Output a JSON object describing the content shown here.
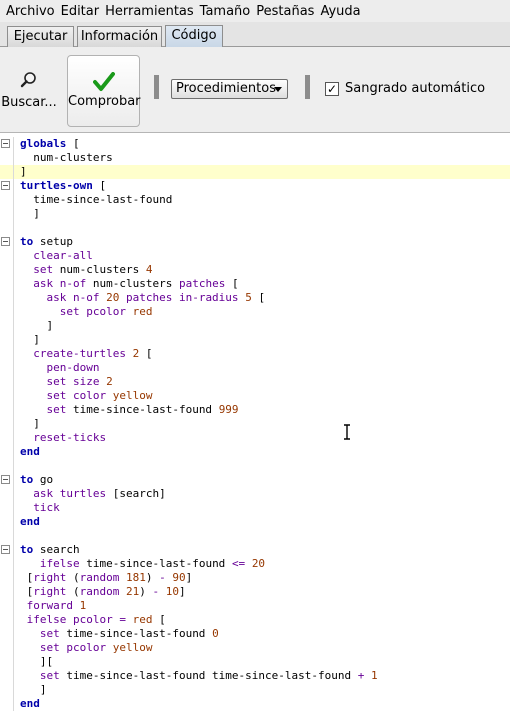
{
  "menu": [
    "Archivo",
    "Editar",
    "Herramientas",
    "Tamaño",
    "Pestañas",
    "Ayuda"
  ],
  "tabs": [
    "Ejecutar",
    "Información",
    "Código"
  ],
  "active_tab": "Código",
  "toolbar": {
    "find_label": "Buscar...",
    "check_label": "Comprobar",
    "procedures_label": "Procedimientos",
    "auto_indent_label": "Sangrado automático",
    "auto_indent_checked": true,
    "check_mark": "✓"
  },
  "code_lines": [
    {
      "fold": true,
      "parts": [
        {
          "t": "globals ",
          "c": "kw"
        },
        {
          "t": "[",
          "c": "pl"
        }
      ]
    },
    {
      "fold": false,
      "parts": [
        {
          "t": "  num-clusters",
          "c": "pl"
        }
      ]
    },
    {
      "fold": false,
      "hl": true,
      "parts": [
        {
          "t": "]",
          "c": "pl"
        }
      ]
    },
    {
      "fold": true,
      "parts": [
        {
          "t": "turtles-own ",
          "c": "kw"
        },
        {
          "t": "[",
          "c": "pl"
        }
      ]
    },
    {
      "fold": false,
      "parts": [
        {
          "t": "  time-since-last-found",
          "c": "pl"
        }
      ]
    },
    {
      "fold": false,
      "parts": [
        {
          "t": "  ]",
          "c": "pl"
        }
      ]
    },
    {
      "fold": false,
      "parts": []
    },
    {
      "fold": true,
      "parts": [
        {
          "t": "to ",
          "c": "kw"
        },
        {
          "t": "setup",
          "c": "pl"
        }
      ]
    },
    {
      "fold": false,
      "parts": [
        {
          "t": "  clear-all",
          "c": "prim"
        }
      ]
    },
    {
      "fold": false,
      "parts": [
        {
          "t": "  set ",
          "c": "prim"
        },
        {
          "t": "num-clusters ",
          "c": "pl"
        },
        {
          "t": "4",
          "c": "num"
        }
      ]
    },
    {
      "fold": false,
      "parts": [
        {
          "t": "  ask n-of ",
          "c": "prim"
        },
        {
          "t": "num-clusters ",
          "c": "pl"
        },
        {
          "t": "patches ",
          "c": "prim"
        },
        {
          "t": "[",
          "c": "pl"
        }
      ]
    },
    {
      "fold": false,
      "parts": [
        {
          "t": "    ask n-of ",
          "c": "prim"
        },
        {
          "t": "20 ",
          "c": "num"
        },
        {
          "t": "patches in-radius ",
          "c": "prim"
        },
        {
          "t": "5 ",
          "c": "num"
        },
        {
          "t": "[",
          "c": "pl"
        }
      ]
    },
    {
      "fold": false,
      "parts": [
        {
          "t": "      set ",
          "c": "prim"
        },
        {
          "t": "pcolor ",
          "c": "prim"
        },
        {
          "t": "red",
          "c": "cst"
        }
      ]
    },
    {
      "fold": false,
      "parts": [
        {
          "t": "    ]",
          "c": "pl"
        }
      ]
    },
    {
      "fold": false,
      "parts": [
        {
          "t": "  ]",
          "c": "pl"
        }
      ]
    },
    {
      "fold": false,
      "parts": [
        {
          "t": "  create-turtles ",
          "c": "prim"
        },
        {
          "t": "2 ",
          "c": "num"
        },
        {
          "t": "[",
          "c": "pl"
        }
      ]
    },
    {
      "fold": false,
      "parts": [
        {
          "t": "    pen-down",
          "c": "prim"
        }
      ]
    },
    {
      "fold": false,
      "parts": [
        {
          "t": "    set ",
          "c": "prim"
        },
        {
          "t": "size ",
          "c": "prim"
        },
        {
          "t": "2",
          "c": "num"
        }
      ]
    },
    {
      "fold": false,
      "parts": [
        {
          "t": "    set ",
          "c": "prim"
        },
        {
          "t": "color ",
          "c": "prim"
        },
        {
          "t": "yellow",
          "c": "cst"
        }
      ]
    },
    {
      "fold": false,
      "parts": [
        {
          "t": "    set ",
          "c": "prim"
        },
        {
          "t": "time-since-last-found ",
          "c": "pl"
        },
        {
          "t": "999",
          "c": "num"
        }
      ]
    },
    {
      "fold": false,
      "parts": [
        {
          "t": "  ]",
          "c": "pl"
        }
      ]
    },
    {
      "fold": false,
      "parts": [
        {
          "t": "  reset-ticks",
          "c": "prim"
        }
      ]
    },
    {
      "fold": false,
      "parts": [
        {
          "t": "end",
          "c": "kw"
        }
      ]
    },
    {
      "fold": false,
      "parts": []
    },
    {
      "fold": true,
      "parts": [
        {
          "t": "to ",
          "c": "kw"
        },
        {
          "t": "go",
          "c": "pl"
        }
      ]
    },
    {
      "fold": false,
      "parts": [
        {
          "t": "  ask ",
          "c": "prim"
        },
        {
          "t": "turtles ",
          "c": "prim"
        },
        {
          "t": "[search]",
          "c": "pl"
        }
      ]
    },
    {
      "fold": false,
      "parts": [
        {
          "t": "  tick",
          "c": "prim"
        }
      ]
    },
    {
      "fold": false,
      "parts": [
        {
          "t": "end",
          "c": "kw"
        }
      ]
    },
    {
      "fold": false,
      "parts": []
    },
    {
      "fold": true,
      "parts": [
        {
          "t": "to ",
          "c": "kw"
        },
        {
          "t": "search",
          "c": "pl"
        }
      ]
    },
    {
      "fold": false,
      "parts": [
        {
          "t": "   ifelse ",
          "c": "prim"
        },
        {
          "t": "time-since-last-found ",
          "c": "pl"
        },
        {
          "t": "<= ",
          "c": "prim"
        },
        {
          "t": "20",
          "c": "num"
        }
      ]
    },
    {
      "fold": false,
      "parts": [
        {
          "t": " [",
          "c": "pl"
        },
        {
          "t": "right ",
          "c": "prim"
        },
        {
          "t": "(",
          "c": "pl"
        },
        {
          "t": "random ",
          "c": "prim"
        },
        {
          "t": "181",
          "c": "num"
        },
        {
          "t": ") ",
          "c": "pl"
        },
        {
          "t": "- ",
          "c": "prim"
        },
        {
          "t": "90",
          "c": "num"
        },
        {
          "t": "]",
          "c": "pl"
        }
      ]
    },
    {
      "fold": false,
      "parts": [
        {
          "t": " [",
          "c": "pl"
        },
        {
          "t": "right ",
          "c": "prim"
        },
        {
          "t": "(",
          "c": "pl"
        },
        {
          "t": "random ",
          "c": "prim"
        },
        {
          "t": "21",
          "c": "num"
        },
        {
          "t": ") ",
          "c": "pl"
        },
        {
          "t": "- ",
          "c": "prim"
        },
        {
          "t": "10",
          "c": "num"
        },
        {
          "t": "]",
          "c": "pl"
        }
      ]
    },
    {
      "fold": false,
      "parts": [
        {
          "t": " forward ",
          "c": "prim"
        },
        {
          "t": "1",
          "c": "num"
        }
      ]
    },
    {
      "fold": false,
      "parts": [
        {
          "t": " ifelse ",
          "c": "prim"
        },
        {
          "t": "pcolor ",
          "c": "prim"
        },
        {
          "t": "= ",
          "c": "prim"
        },
        {
          "t": "red ",
          "c": "cst"
        },
        {
          "t": "[",
          "c": "pl"
        }
      ]
    },
    {
      "fold": false,
      "parts": [
        {
          "t": "   set ",
          "c": "prim"
        },
        {
          "t": "time-since-last-found ",
          "c": "pl"
        },
        {
          "t": "0",
          "c": "num"
        }
      ]
    },
    {
      "fold": false,
      "parts": [
        {
          "t": "   set ",
          "c": "prim"
        },
        {
          "t": "pcolor ",
          "c": "prim"
        },
        {
          "t": "yellow",
          "c": "cst"
        }
      ]
    },
    {
      "fold": false,
      "parts": [
        {
          "t": "   ][",
          "c": "pl"
        }
      ]
    },
    {
      "fold": false,
      "parts": [
        {
          "t": "   set ",
          "c": "prim"
        },
        {
          "t": "time-since-last-found time-since-last-found ",
          "c": "pl"
        },
        {
          "t": "+ ",
          "c": "prim"
        },
        {
          "t": "1",
          "c": "num"
        }
      ]
    },
    {
      "fold": false,
      "parts": [
        {
          "t": "   ]",
          "c": "pl"
        }
      ]
    },
    {
      "fold": false,
      "parts": [
        {
          "t": "end",
          "c": "kw"
        }
      ]
    }
  ]
}
